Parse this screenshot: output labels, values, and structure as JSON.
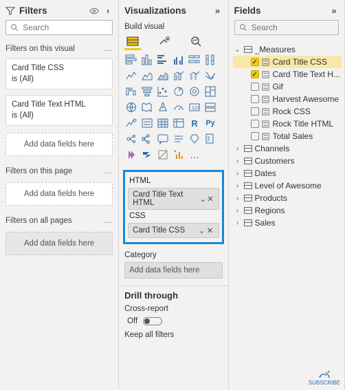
{
  "filters": {
    "title": "Filters",
    "search_placeholder": "Search",
    "visual_section": "Filters on this visual",
    "page_section": "Filters on this page",
    "all_section": "Filters on all pages",
    "add_text": "Add data fields here",
    "cards": [
      {
        "field": "Card Title CSS",
        "summary": "is (All)"
      },
      {
        "field": "Card Title Text HTML",
        "summary": "is (All)"
      }
    ]
  },
  "viz": {
    "title": "Visualizations",
    "build_label": "Build visual",
    "wells": {
      "html_label": "HTML",
      "html_field": "Card Title Text HTML",
      "css_label": "CSS",
      "css_field": "Card Title CSS",
      "category_label": "Category",
      "category_drop": "Add data fields here"
    },
    "drill": {
      "header": "Drill through",
      "cross": "Cross-report",
      "off": "Off",
      "keep": "Keep all filters"
    },
    "r_label": "R",
    "py_label": "Py"
  },
  "fields": {
    "title": "Fields",
    "search_placeholder": "Search",
    "measures": "_Measures",
    "items": [
      {
        "label": "Card Title CSS",
        "checked": true,
        "selected": true
      },
      {
        "label": "Card Title Text H...",
        "checked": true
      },
      {
        "label": "Gif",
        "checked": false
      },
      {
        "label": "Harvest Awesome",
        "checked": false
      },
      {
        "label": "Rock CSS",
        "checked": false
      },
      {
        "label": "Rock Title HTML",
        "checked": false
      },
      {
        "label": "Total Sales",
        "checked": false
      }
    ],
    "tables": [
      "Channels",
      "Customers",
      "Dates",
      "Level of Awesome",
      "Products",
      "Regions",
      "Sales"
    ]
  },
  "subscribe": "SUBSCRIBE"
}
